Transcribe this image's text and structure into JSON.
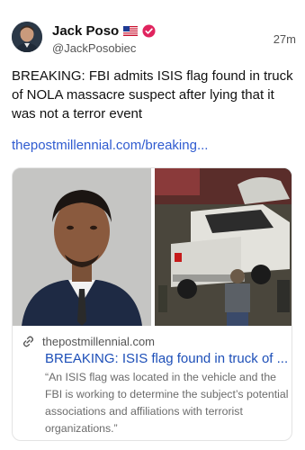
{
  "author": {
    "name": "Jack Poso",
    "handle": "@JackPosobiec",
    "time": "27m"
  },
  "post": {
    "text": "BREAKING: FBI admits ISIS flag found in truck of NOLA massacre suspect after lying that it was not a terror event",
    "link": "thepostmillennial.com/breaking..."
  },
  "card": {
    "domain": "thepostmillennial.com",
    "title": "BREAKING: ISIS flag found in truck of ...",
    "description": "“An ISIS flag was located in the vehicle and the FBI is working to determine the subject’s potential associations and affiliations with terrorist organizations.”"
  },
  "colors": {
    "link": "#2f5bd0",
    "verified_badge": "#e0245e"
  },
  "icons": [
    "us-flag-icon",
    "verified-badge-icon",
    "link-icon"
  ]
}
